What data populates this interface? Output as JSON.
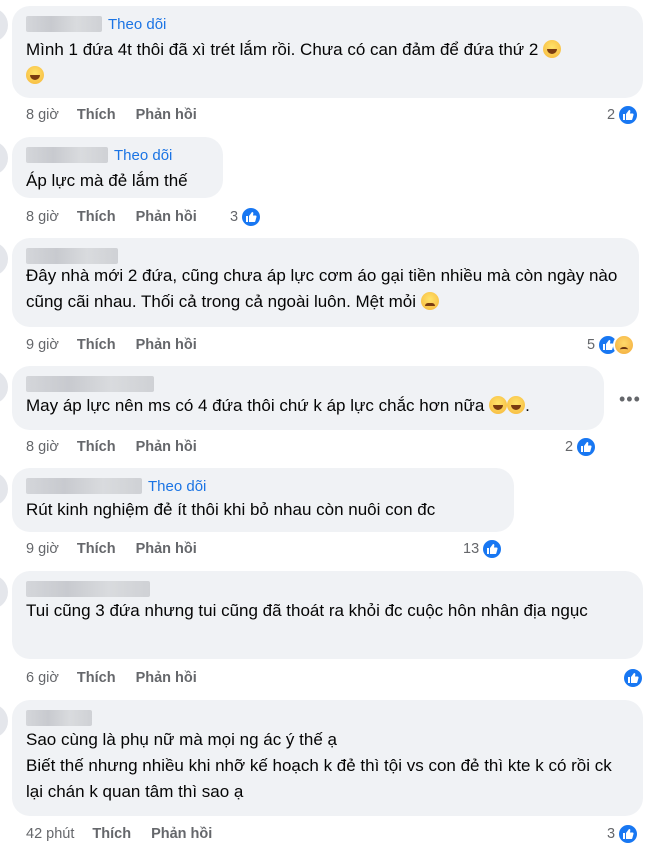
{
  "comments": [
    {
      "follow": "Theo dõi",
      "text": "Mình 1 đứa 4t thôi đã xì trét lắm rồi. Chưa có can đảm để đứa thứ 2",
      "time": "8 giờ",
      "like": "Thích",
      "reply": "Phản hồi",
      "reaction_count": "2"
    },
    {
      "follow": "Theo dõi",
      "text": "Áp lực mà đẻ lắm thế",
      "time": "8 giờ",
      "like": "Thích",
      "reply": "Phản hồi",
      "reaction_count": "3"
    },
    {
      "follow": "",
      "text": "Đây nhà mới 2 đứa, cũng chưa áp lực cơm áo gại tiền nhiều mà còn ngày nào cũng cãi nhau. Thối cả trong cả ngoài luôn. Mệt mỏi",
      "time": "9 giờ",
      "like": "Thích",
      "reply": "Phản hồi",
      "reaction_count": "5"
    },
    {
      "follow": "",
      "text": "May áp lực nên ms có 4 đứa thôi chứ k áp lực chắc hơn nữa",
      "text_suffix": ".",
      "time": "8 giờ",
      "like": "Thích",
      "reply": "Phản hồi",
      "reaction_count": "2"
    },
    {
      "follow": "Theo dõi",
      "text": "Rút kinh nghiệm đẻ ít thôi khi bỏ nhau còn nuôi con đc",
      "time": "9 giờ",
      "like": "Thích",
      "reply": "Phản hồi",
      "reaction_count": "13"
    },
    {
      "follow": "",
      "text": "Tui cũng 3 đứa nhưng tui cũng đã thoát ra khỏi đc cuộc hôn nhân địa ngục",
      "time": "6 giờ",
      "like": "Thích",
      "reply": "Phản hồi",
      "reaction_count": ""
    },
    {
      "follow": "",
      "text": "Sao cùng là phụ nữ mà mọi ng ác ý thế ạ\nBiết thế nhưng nhiều khi nhỡ kế hoạch k đẻ thì tội vs con đẻ thì kte k có rồi ck lại chán k quan tâm thì sao ạ",
      "time": "42 phút",
      "like": "Thích",
      "reply": "Phản hồi",
      "reaction_count": "3"
    }
  ],
  "more_options": "•••",
  "icons": {
    "like": "like-icon",
    "sad": "sad-reaction-icon",
    "laugh": "laughing-emoji-icon",
    "more": "more-options-icon"
  },
  "colors": {
    "bubble": "#f0f2f5",
    "follow": "#1b74e4",
    "meta": "#65676b",
    "like": "#1877f2"
  }
}
